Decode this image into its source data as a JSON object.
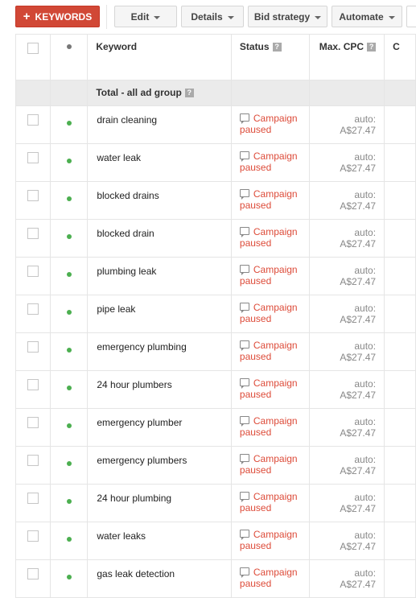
{
  "toolbar": {
    "add_button": {
      "icon": "plus-icon",
      "label": "KEYWORDS"
    },
    "buttons": [
      {
        "label": "Edit",
        "icon": "caret-down-icon"
      },
      {
        "label": "Details",
        "icon": "caret-down-icon"
      },
      {
        "label": "Bid strategy",
        "icon": "caret-down-icon"
      },
      {
        "label": "Automate",
        "icon": "caret-down-icon"
      }
    ]
  },
  "table": {
    "headers": {
      "keyword": "Keyword",
      "status": "Status",
      "max_cpc": "Max. CPC",
      "next_partial": "C",
      "help_glyph": "?"
    },
    "total_row": {
      "label": "Total - all ad group"
    },
    "rows": [
      {
        "keyword": "drain cleaning",
        "status_line1": "Campaign",
        "status_line2": "paused",
        "max_cpc": "auto: A$27.47"
      },
      {
        "keyword": "water leak",
        "status_line1": "Campaign",
        "status_line2": "paused",
        "max_cpc": "auto: A$27.47"
      },
      {
        "keyword": "blocked drains",
        "status_line1": "Campaign",
        "status_line2": "paused",
        "max_cpc": "auto: A$27.47"
      },
      {
        "keyword": "blocked drain",
        "status_line1": "Campaign",
        "status_line2": "paused",
        "max_cpc": "auto: A$27.47"
      },
      {
        "keyword": "plumbing leak",
        "status_line1": "Campaign",
        "status_line2": "paused",
        "max_cpc": "auto: A$27.47"
      },
      {
        "keyword": "pipe leak",
        "status_line1": "Campaign",
        "status_line2": "paused",
        "max_cpc": "auto: A$27.47"
      },
      {
        "keyword": "emergency plumbing",
        "status_line1": "Campaign",
        "status_line2": "paused",
        "max_cpc": "auto: A$27.47"
      },
      {
        "keyword": "24 hour plumbers",
        "status_line1": "Campaign",
        "status_line2": "paused",
        "max_cpc": "auto: A$27.47"
      },
      {
        "keyword": "emergency plumber",
        "status_line1": "Campaign",
        "status_line2": "paused",
        "max_cpc": "auto: A$27.47"
      },
      {
        "keyword": "emergency plumbers",
        "status_line1": "Campaign",
        "status_line2": "paused",
        "max_cpc": "auto: A$27.47"
      },
      {
        "keyword": "24 hour plumbing",
        "status_line1": "Campaign",
        "status_line2": "paused",
        "max_cpc": "auto: A$27.47"
      },
      {
        "keyword": "water leaks",
        "status_line1": "Campaign",
        "status_line2": "paused",
        "max_cpc": "auto: A$27.47"
      },
      {
        "keyword": "gas leak detection",
        "status_line1": "Campaign",
        "status_line2": "paused",
        "max_cpc": "auto: A$27.47"
      }
    ]
  },
  "colors": {
    "primary_button": "#d14836",
    "status_paused": "#dd4b39",
    "enabled_dot": "#4caf50",
    "total_row_bg": "#ebebeb"
  }
}
